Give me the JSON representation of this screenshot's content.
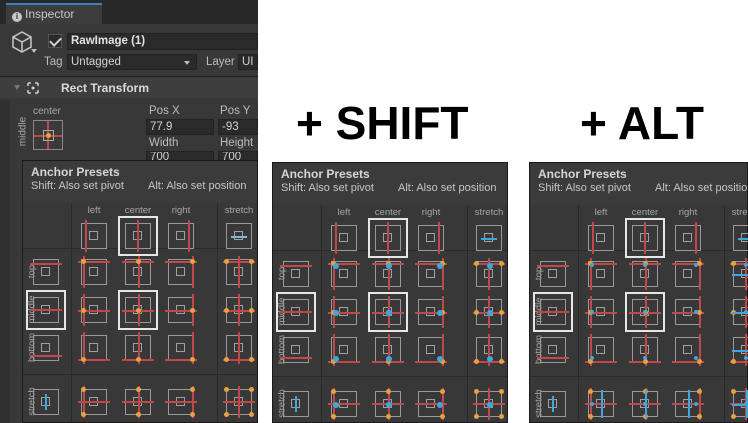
{
  "inspector": {
    "tab_label": "Inspector",
    "object_name": "RawImage (1)",
    "tag_label": "Tag",
    "tag_value": "Untagged",
    "layer_label": "Layer",
    "layer_value": "UI",
    "component_title": "Rect Transform",
    "anchor_label_top": "center",
    "anchor_label_side": "middle",
    "posx_label": "Pos X",
    "posy_label": "Pos Y",
    "posx_value": "77.9",
    "posy_value": "-93",
    "width_label": "Width",
    "height_label": "Height",
    "width_value": "700",
    "height_value": "700"
  },
  "captions": {
    "shift": "+ SHIFT",
    "alt": "+ ALT"
  },
  "popup": {
    "title": "Anchor Presets",
    "shift_hint": "Shift: Also set pivot",
    "alt_hint": "Alt: Also set position",
    "columns": [
      "left",
      "center",
      "right",
      "stretch"
    ],
    "rows": [
      "top",
      "middle",
      "bottom",
      "stretch"
    ]
  },
  "colors": {
    "panel_bg": "#383838",
    "anchor_red": "#c04848",
    "pivot_blue": "#3fa7dc",
    "corner_orange": "#e6a23c"
  }
}
